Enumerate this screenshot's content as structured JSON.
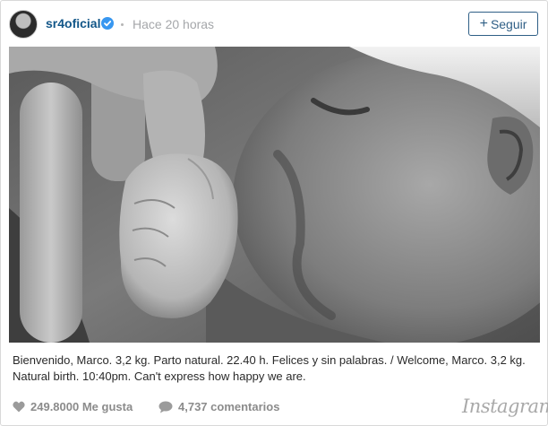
{
  "post": {
    "username": "sr4oficial",
    "verified_icon": "verified-badge-icon",
    "timestamp": "Hace 20 horas",
    "follow_label": "Seguir",
    "follow_icon": "plus-icon",
    "caption": "Bienvenido, Marco. 3,2 kg. Parto natural. 22.40 h. Felices y sin palabras. / Welcome, Marco. 3,2 kg. Natural birth. 10:40pm. Can't express how happy we are.",
    "likes": "249.8000 Me gusta",
    "likes_icon": "heart-icon",
    "comments": "4,737 comentarios",
    "comments_icon": "comment-bubble-icon",
    "logo": "Instagram"
  },
  "colors": {
    "username": "#125688",
    "verified": "#3897f0",
    "follow_border": "#2f5f86",
    "muted": "#a5a7aa"
  }
}
